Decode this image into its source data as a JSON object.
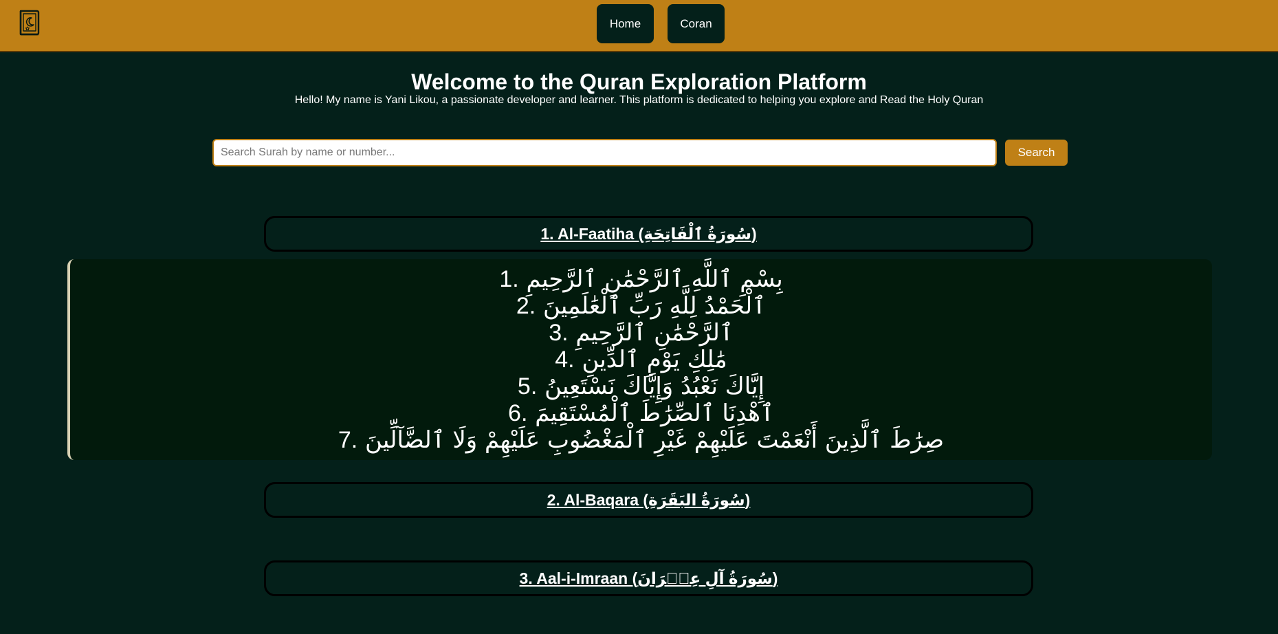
{
  "nav": {
    "home_label": "Home",
    "coran_label": "Coran",
    "logo_icon": "quran-book-icon"
  },
  "hero": {
    "title": "Welcome to the Quran Exploration Platform",
    "subtitle": "Hello! My name is Yani Likou, a passionate developer and learner. This platform is dedicated to helping you explore and Read the Holy Quran"
  },
  "search": {
    "placeholder": "Search Surah by name or number...",
    "value": "",
    "button_label": "Search"
  },
  "surahs": [
    {
      "title": "1. Al-Faatiha (سُورَةُ ٱلْفَاتِحَةِ)",
      "expanded": true
    },
    {
      "title": "2. Al-Baqara (سُورَةُ البَقَرَةِ)",
      "expanded": false
    },
    {
      "title": "3. Aal-i-Imraan (سُورَةُ آلِ عِمۡرَانَ)",
      "expanded": false
    }
  ],
  "ayahs": [
    {
      "number": "1.",
      "text": "بِسْمِ ٱللَّهِ ٱلرَّحْمَٰنِ ٱلرَّحِيمِ"
    },
    {
      "number": "2.",
      "text": "ٱلْحَمْدُ لِلَّهِ رَبِّ ٱلْعَٰلَمِينَ"
    },
    {
      "number": "3.",
      "text": "ٱلرَّحْمَٰنِ ٱلرَّحِيمِ"
    },
    {
      "number": "4.",
      "text": "مَٰلِكِ يَوْمِ ٱلدِّينِ"
    },
    {
      "number": "5.",
      "text": "إِيَّاكَ نَعْبُدُ وَإِيَّاكَ نَسْتَعِينُ"
    },
    {
      "number": "6.",
      "text": "ٱهْدِنَا ٱلصِّرَٰطَ ٱلْمُسْتَقِيمَ"
    },
    {
      "number": "7.",
      "text": "صِرَٰطَ ٱلَّذِينَ أَنْعَمْتَ عَلَيْهِمْ غَيْرِ ٱلْمَغْضُوبِ عَلَيْهِمْ وَلَا ٱلضَّآلِّينَ"
    }
  ],
  "colors": {
    "background": "#04201a",
    "accent": "#bf8016",
    "panel": "#021a0c",
    "text": "#ffffff"
  }
}
